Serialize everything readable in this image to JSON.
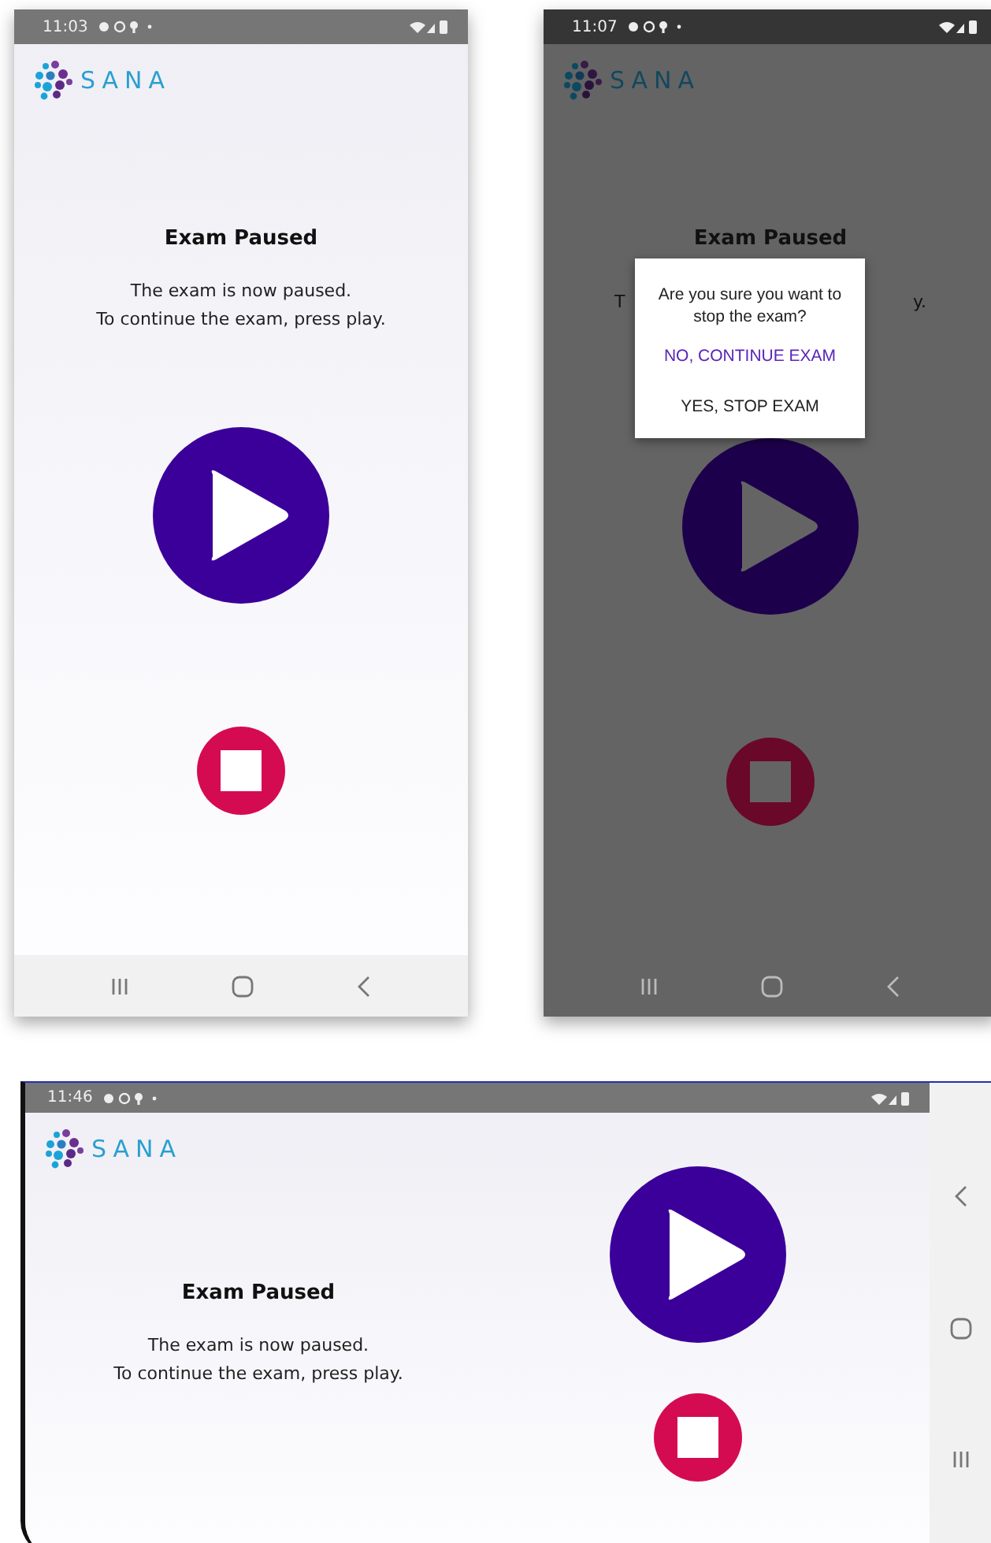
{
  "screens": [
    {
      "kind": "portrait",
      "dimmed": false,
      "status_bar": {
        "time": "11:03"
      },
      "logo": {
        "text": "SANA"
      },
      "title": "Exam Paused",
      "message": [
        "The exam is now paused.",
        "To continue the exam, press play."
      ]
    },
    {
      "kind": "portrait",
      "dimmed": true,
      "status_bar": {
        "time": "11:07"
      },
      "logo": {
        "text": "SANA"
      },
      "title": "Exam Paused",
      "message_fragments": [
        "T",
        "y."
      ],
      "dialog": {
        "question": "Are you sure you want to stop the exam?",
        "actions": [
          {
            "label": "NO, CONTINUE EXAM",
            "kind": "primary"
          },
          {
            "label": "YES, STOP EXAM",
            "kind": "secondary"
          }
        ]
      }
    },
    {
      "kind": "landscape",
      "dimmed": false,
      "status_bar": {
        "time": "11:46"
      },
      "logo": {
        "text": "SANA"
      },
      "title": "Exam Paused",
      "message": [
        "The exam is now paused.",
        "To continue the exam, press play."
      ]
    }
  ]
}
